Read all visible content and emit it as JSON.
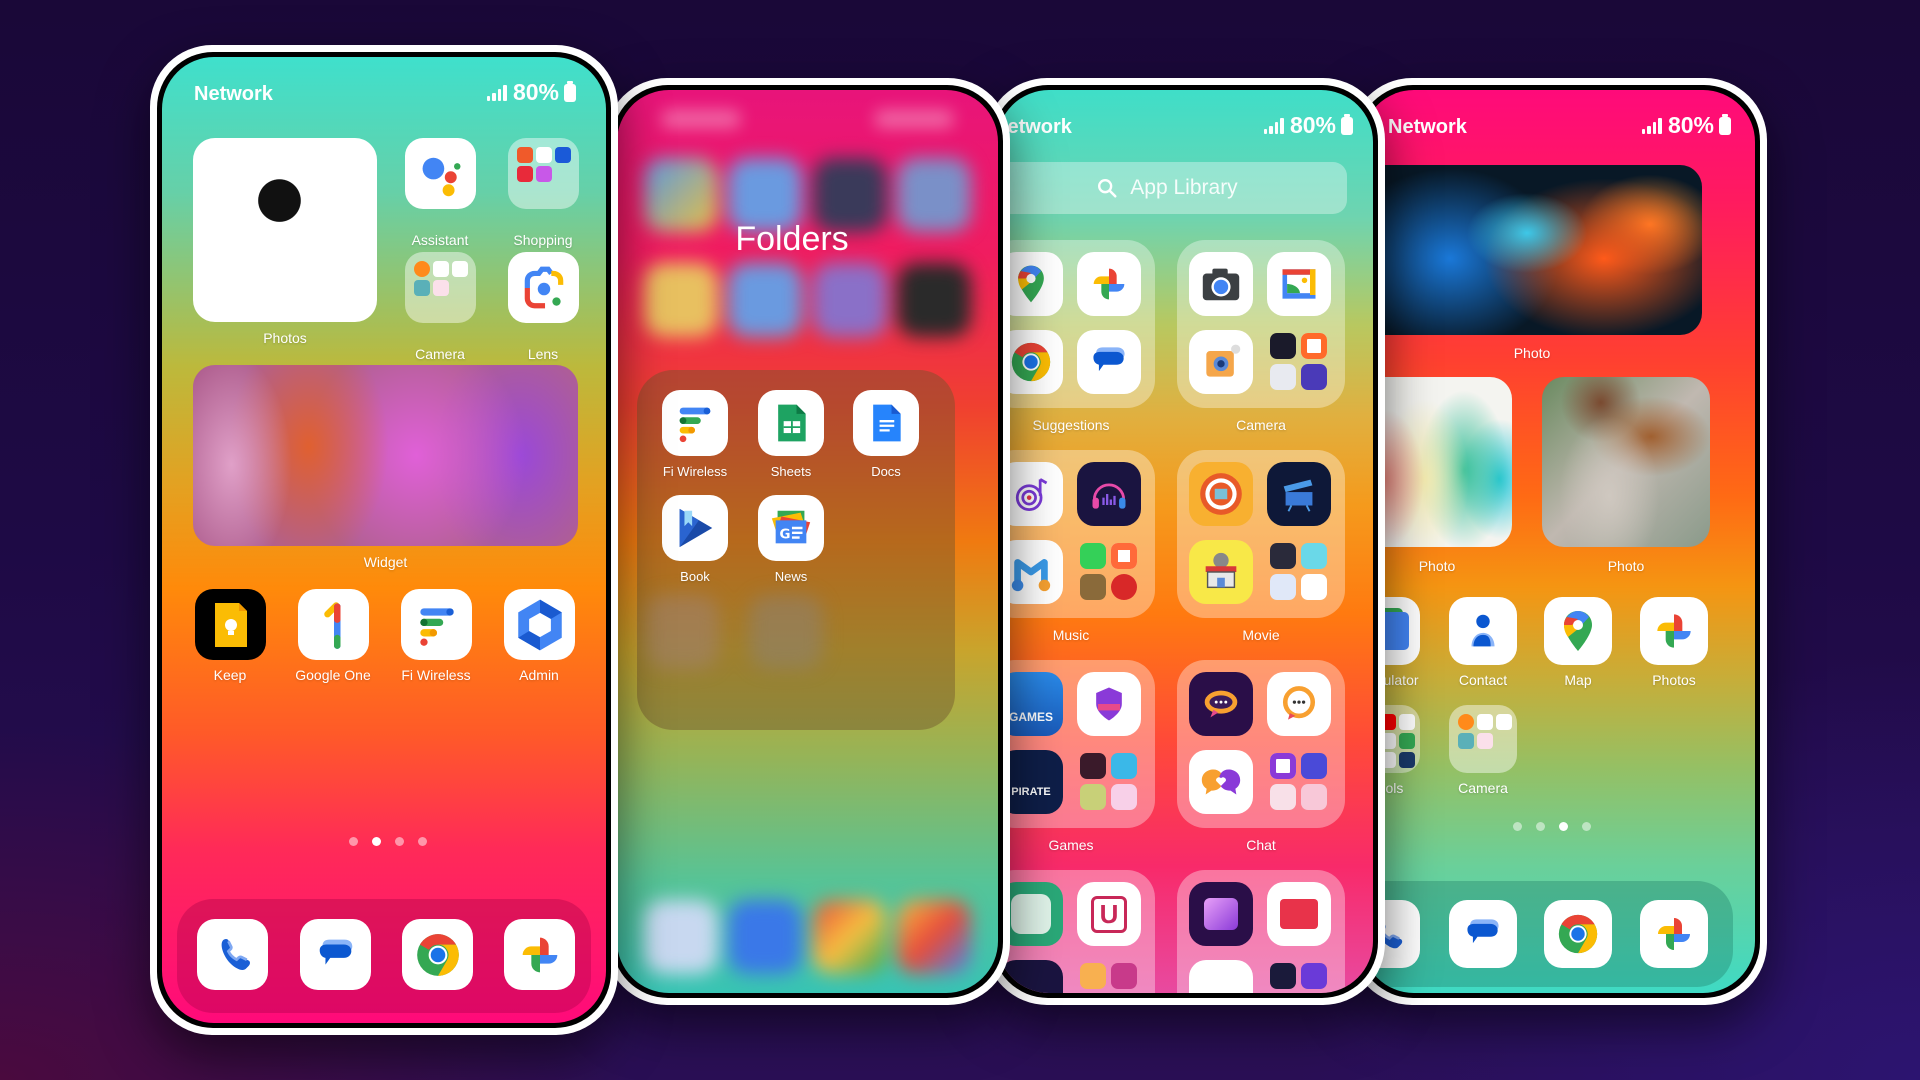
{
  "status": {
    "carrier": "Network",
    "battery": "80%"
  },
  "phone1": {
    "widgets": {
      "photos_label": "Photos",
      "widget_label": "Widget"
    },
    "apps": [
      {
        "label": "Assistant",
        "icon": "google-assistant-icon"
      },
      {
        "label": "Shopping",
        "icon": "shopping-folder-icon"
      },
      {
        "label": "Camera",
        "icon": "camera-folder-icon"
      },
      {
        "label": "Lens",
        "icon": "google-lens-icon"
      },
      {
        "label": "Keep",
        "icon": "google-keep-icon"
      },
      {
        "label": "Google One",
        "icon": "google-one-icon"
      },
      {
        "label": "Fi Wireless",
        "icon": "google-fi-icon"
      },
      {
        "label": "Admin",
        "icon": "google-admin-icon"
      }
    ],
    "pages": {
      "count": 4,
      "active": 2
    },
    "dock": [
      "phone-icon",
      "messages-icon",
      "chrome-icon",
      "google-photos-icon"
    ]
  },
  "phone2": {
    "title": "Folders",
    "apps": [
      {
        "label": "Fi Wireless",
        "icon": "google-fi-icon"
      },
      {
        "label": "Sheets",
        "icon": "google-sheets-icon"
      },
      {
        "label": "Docs",
        "icon": "google-docs-icon"
      },
      {
        "label": "Book",
        "icon": "play-books-icon"
      },
      {
        "label": "News",
        "icon": "google-news-icon"
      }
    ]
  },
  "phone3": {
    "search_placeholder": "App Library",
    "categories": [
      {
        "label": "Suggestions"
      },
      {
        "label": "Camera"
      },
      {
        "label": "Music"
      },
      {
        "label": "Movie"
      },
      {
        "label": "Games"
      },
      {
        "label": "Chat"
      }
    ]
  },
  "phone4": {
    "photos": [
      {
        "label": "Photo"
      },
      {
        "label": "Photo"
      },
      {
        "label": "Photo"
      }
    ],
    "apps": [
      {
        "label": "Calculator",
        "icon": "calculator-icon"
      },
      {
        "label": "Contact",
        "icon": "contacts-icon"
      },
      {
        "label": "Map",
        "icon": "google-maps-icon"
      },
      {
        "label": "Photos",
        "icon": "google-photos-icon"
      },
      {
        "label": "Tools",
        "icon": "tools-folder-icon"
      },
      {
        "label": "Camera",
        "icon": "camera-folder-icon"
      }
    ],
    "pages": {
      "count": 4,
      "active": 3
    }
  },
  "colors": {
    "google_blue": "#4285f4",
    "google_red": "#ea4335",
    "google_yellow": "#fbbc04",
    "google_green": "#34a853"
  }
}
